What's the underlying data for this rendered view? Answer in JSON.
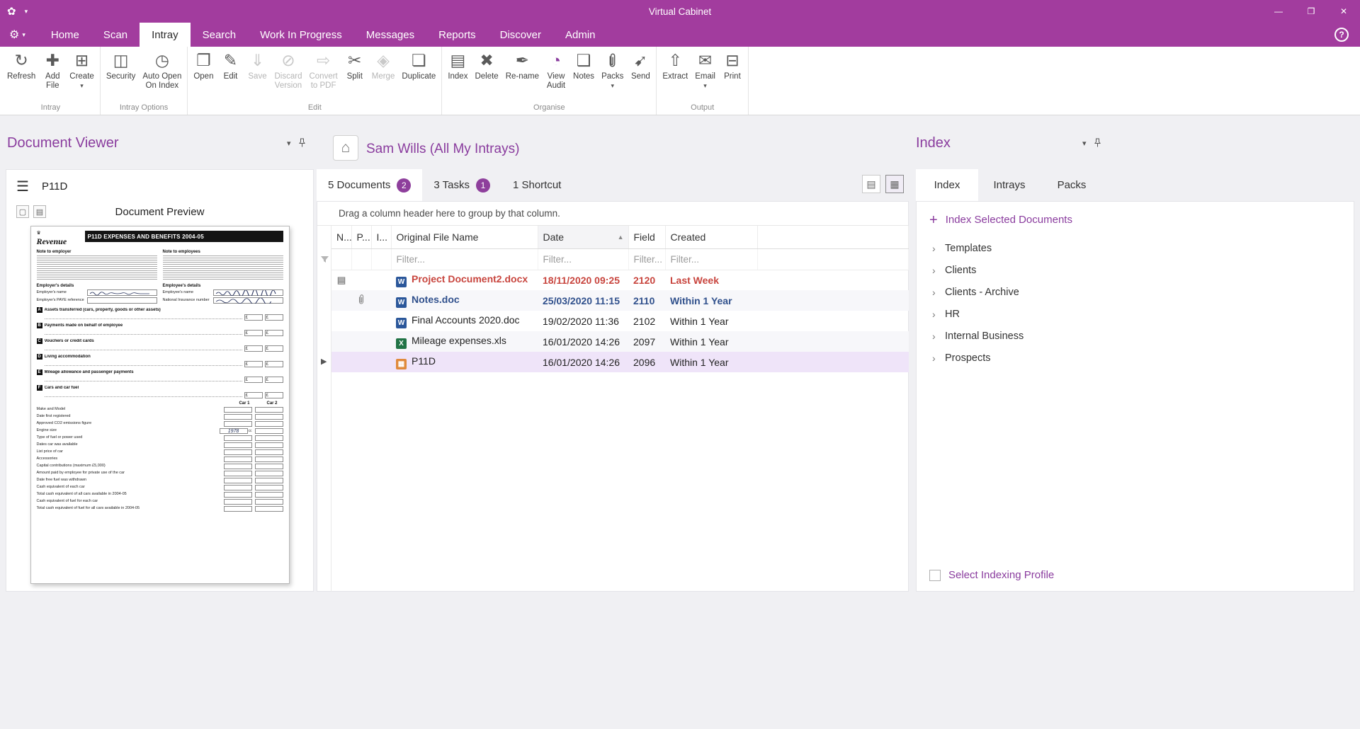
{
  "colors": {
    "magenta": "#A23C9E",
    "accent_purple": "#8A3C9E",
    "badge_purple": "#8E3F9C",
    "red_row": "#C8453E",
    "blue_row": "#30508C",
    "selected_row_bg": "#EFE4F9"
  },
  "title_bar": {
    "title": "Virtual Cabinet",
    "minimize": "—",
    "maximize": "❐",
    "close": "✕"
  },
  "menu": {
    "active": "Intray",
    "help": "?",
    "tabs": [
      "Home",
      "Scan",
      "Intray",
      "Search",
      "Work In Progress",
      "Messages",
      "Reports",
      "Discover",
      "Admin"
    ]
  },
  "ribbon": {
    "groups": [
      {
        "name": "Intray",
        "buttons": [
          {
            "label": "Refresh",
            "icon": "refresh"
          },
          {
            "label": "Add\nFile",
            "icon": "add-file"
          },
          {
            "label": "Create",
            "icon": "create",
            "caret": true
          }
        ]
      },
      {
        "name": "Intray Options",
        "buttons": [
          {
            "label": "Security",
            "icon": "security"
          },
          {
            "label": "Auto Open\nOn Index",
            "icon": "auto-open"
          }
        ]
      },
      {
        "name": "Edit",
        "buttons": [
          {
            "label": "Open",
            "icon": "open"
          },
          {
            "label": "Edit",
            "icon": "edit"
          },
          {
            "label": "Save",
            "icon": "save",
            "disabled": true
          },
          {
            "label": "Discard\nVersion",
            "icon": "discard",
            "disabled": true
          },
          {
            "label": "Convert\nto PDF",
            "icon": "convert-pdf",
            "disabled": true
          },
          {
            "label": "Split",
            "icon": "split"
          },
          {
            "label": "Merge",
            "icon": "merge",
            "disabled": true
          },
          {
            "label": "Duplicate",
            "icon": "duplicate"
          }
        ]
      },
      {
        "name": "Organise",
        "buttons": [
          {
            "label": "Index",
            "icon": "index"
          },
          {
            "label": "Delete",
            "icon": "delete"
          },
          {
            "label": "Re-name",
            "icon": "rename"
          },
          {
            "label": "View\nAudit",
            "icon": "view-audit"
          },
          {
            "label": "Notes",
            "icon": "notes"
          },
          {
            "label": "Packs",
            "icon": "packs",
            "caret": true
          },
          {
            "label": "Send",
            "icon": "send"
          }
        ]
      },
      {
        "name": "Output",
        "buttons": [
          {
            "label": "Extract",
            "icon": "extract"
          },
          {
            "label": "Email",
            "icon": "email",
            "caret": true
          },
          {
            "label": "Print",
            "icon": "print"
          }
        ]
      }
    ]
  },
  "viewer": {
    "title": "Document Viewer",
    "doc_title": "P11D",
    "preview_title": "Document Preview",
    "form": {
      "brand": "Revenue",
      "title": "P11D EXPENSES AND BENEFITS 2004-05",
      "note_left": "Note to employer",
      "note_right": "Note to employees",
      "employer_heading": "Employer's details",
      "employee_heading": "Employee's details",
      "employer_name_label": "Employer's name",
      "paye_label": "Employer's PAYE reference",
      "employee_name_label": "Employee's name",
      "ni_label": "National Insurance number",
      "car1": "Car 1",
      "car2": "Car 2",
      "sections": [
        {
          "letter": "A",
          "title": "Assets transferred (cars, property, goods or other assets)"
        },
        {
          "letter": "B",
          "title": "Payments made on behalf of employee"
        },
        {
          "letter": "C",
          "title": "Vouchers or credit cards"
        },
        {
          "letter": "D",
          "title": "Living accommodation"
        },
        {
          "letter": "E",
          "title": "Mileage allowance and passenger payments"
        },
        {
          "letter": "F",
          "title": "Cars and car fuel"
        }
      ],
      "car_rows": [
        {
          "label": "Make and Model"
        },
        {
          "label": "Date first registered"
        },
        {
          "label": "Approved CO2 emissions figure"
        },
        {
          "label": "Engine size",
          "value": "1978",
          "suffix": "cc"
        },
        {
          "label": "Type of fuel or power used"
        },
        {
          "label": "Dates car was available"
        },
        {
          "label": "List price of car"
        },
        {
          "label": "Accessories"
        },
        {
          "label": "Capital contributions (maximum £5,000)"
        },
        {
          "label": "Amount paid by employee for private use of the car"
        },
        {
          "label": "Date free fuel was withdrawn"
        },
        {
          "label": "Cash equivalent of each car"
        },
        {
          "label": "Total cash equivalent of all cars available in 2004-05"
        },
        {
          "label": "Cash equivalent of fuel for each car"
        },
        {
          "label": "Total cash equivalent of fuel for all cars available in 2004-05"
        }
      ]
    }
  },
  "intray": {
    "title": "Sam Wills (All My Intrays)",
    "tabs": [
      {
        "label": "5 Documents",
        "badge": "2",
        "active": true
      },
      {
        "label": "3 Tasks",
        "badge": "1"
      },
      {
        "label": "1 Shortcut"
      }
    ],
    "group_hint": "Drag a column header here to group by that column.",
    "filter_placeholder": "Filter...",
    "columns": [
      {
        "label": "N..."
      },
      {
        "label": "P..."
      },
      {
        "label": "I..."
      },
      {
        "label": "Original File Name",
        "filter": true
      },
      {
        "label": "Date",
        "filter": true,
        "sorted": true
      },
      {
        "label": "Field",
        "filter": true
      },
      {
        "label": "Created",
        "filter": true
      }
    ],
    "rows": [
      {
        "file": "Project Document2.docx",
        "icon": "word",
        "date": "18/11/2020 09:25",
        "field": "2120",
        "created": "Last Week",
        "style": "red",
        "note": true
      },
      {
        "file": "Notes.doc",
        "icon": "word",
        "date": "25/03/2020 11:15",
        "field": "2110",
        "created": "Within 1 Year",
        "style": "blue",
        "clip": true
      },
      {
        "file": "Final Accounts 2020.doc",
        "icon": "word",
        "date": "19/02/2020 11:36",
        "field": "2102",
        "created": "Within 1 Year",
        "style": "normal"
      },
      {
        "file": "Mileage expenses.xls",
        "icon": "excel",
        "date": "16/01/2020 14:26",
        "field": "2097",
        "created": "Within 1 Year",
        "style": "normal"
      },
      {
        "file": "P11D",
        "icon": "image",
        "date": "16/01/2020 14:26",
        "field": "2096",
        "created": "Within 1 Year",
        "style": "normal",
        "selected": true
      }
    ]
  },
  "index_panel": {
    "title": "Index",
    "tabs": [
      {
        "label": "Index",
        "active": true
      },
      {
        "label": "Intrays"
      },
      {
        "label": "Packs"
      }
    ],
    "action": "Index Selected Documents",
    "tree": [
      "Templates",
      "Clients",
      "Clients - Archive",
      "HR",
      "Internal Business",
      "Prospects"
    ],
    "footer": "Select Indexing Profile"
  }
}
